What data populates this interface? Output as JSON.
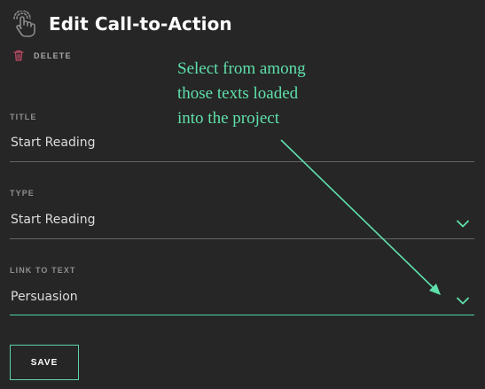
{
  "header": {
    "title": "Edit Call-to-Action",
    "icon": "hand-pointer-icon"
  },
  "delete": {
    "label": "DELETE",
    "icon": "trash-icon"
  },
  "fields": {
    "title": {
      "label": "TITLE",
      "value": "Start Reading"
    },
    "type": {
      "label": "TYPE",
      "value": "Start Reading"
    },
    "link_to_text": {
      "label": "LINK TO TEXT",
      "value": "Persuasion"
    }
  },
  "save": {
    "label": "SAVE"
  },
  "annotation": {
    "lines": [
      "Select from among",
      "those texts loaded",
      "into the project"
    ]
  },
  "colors": {
    "background": "#262626",
    "accent": "#5fe0ab",
    "delete_icon": "#c44b68"
  }
}
